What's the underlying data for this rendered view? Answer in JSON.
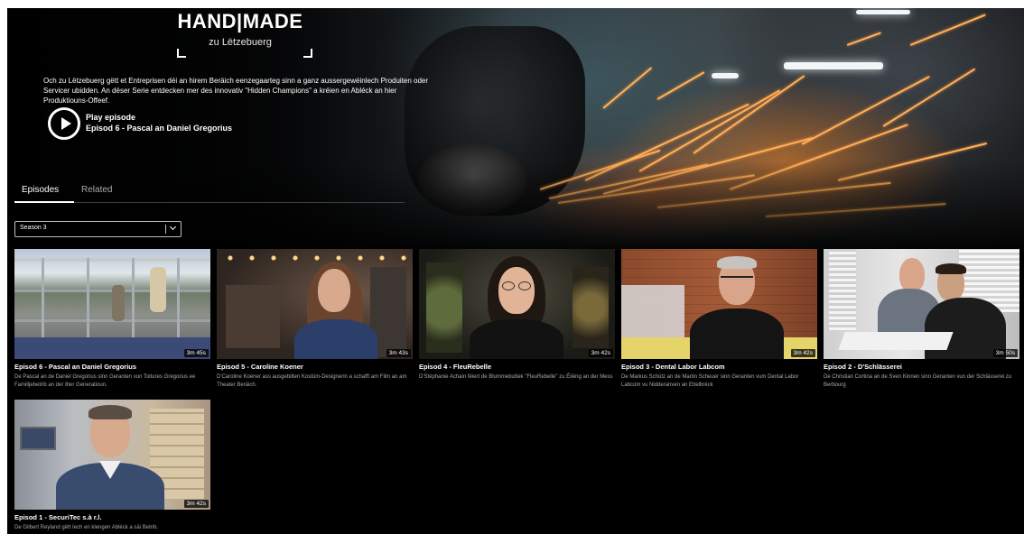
{
  "show": {
    "logo_title": "HAND|MADE",
    "logo_subtitle": "zu Lëtzebuerg",
    "description": "Och zu Lëtzebuerg gëtt et Entreprisen déi an hirem Beräich eenzegaarteg sinn a ganz aussergewéinlech Produiten oder Servicer ubidden. An dëser Serie entdecken mer des innovativ \"Hidden Champions\" a kréien en Abléck an hier Produktiouns-Offeef."
  },
  "play": {
    "label": "Play episode",
    "episode": "Episod 6 - Pascal an Daniel Gregorius"
  },
  "tabs": [
    {
      "label": "Episodes",
      "active": true
    },
    {
      "label": "Related",
      "active": false
    }
  ],
  "season_select": {
    "value": "Season 3"
  },
  "episodes": [
    {
      "title": "Episod 6 - Pascal an Daniel Gregorius",
      "description": "De Pascal an de Daniel Gregorius sinn Geranten vun Toitures Gregorius ee Familljebetrib an der 8ter Generatioun.",
      "duration": "3m 45s"
    },
    {
      "title": "Episod 5 - Caroline Koener",
      "description": "D'Caroline Koener ass ausgebilten Kostüm-Designerin a schafft am Film an am Theater Beräich.",
      "duration": "3m 43s"
    },
    {
      "title": "Episod 4 - FleuRebelle",
      "description": "D'Stéphanie Achain féiert de Blummebuttek \"FleuRebelle\" zu Éilëng an der Mess",
      "duration": "3m 42s"
    },
    {
      "title": "Episod 3 - Dental Labor Labcom",
      "description": "De Markus Schütz an de Martin Scheuer sinn Geranten vum Dental Labor Labcom vu Nidderanven an Ettelbréck",
      "duration": "3m 42s"
    },
    {
      "title": "Episod 2 - D'Schlässerei",
      "description": "De Christian Cortina an de Sven Kinnen sinn Geranten vun der Schlässerei zu Berbourg",
      "duration": "3m 50s"
    },
    {
      "title": "Episod 1 - SecuriTec s.à r.l.",
      "description": "De Gilbert Reyland gëtt Iech en klengen Abléck a säi Betrib.",
      "duration": "3m 42s"
    }
  ]
}
